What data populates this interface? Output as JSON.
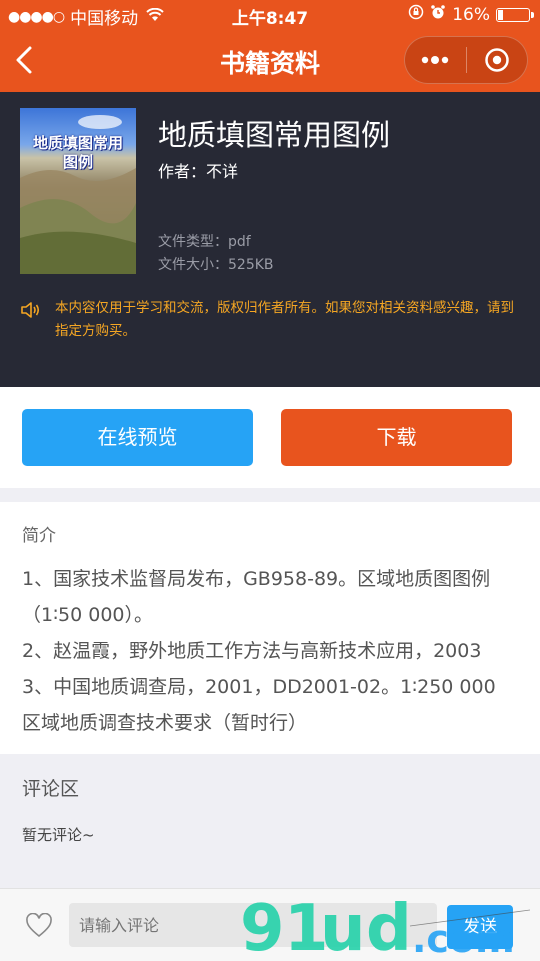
{
  "status_bar": {
    "carrier": "中国移动",
    "time": "上午8:47",
    "battery": "16%"
  },
  "navbar": {
    "title": "书籍资料",
    "icons": [
      "back-arrow-icon",
      "more-dots-icon",
      "close-circle-icon"
    ]
  },
  "book": {
    "cover_text": "地质填图常用图例",
    "title": "地质填图常用图例",
    "author": "作者：不详",
    "file_type": "文件类型：pdf",
    "file_size": "文件大小：525KB",
    "notice": "本内容仅用于学习和交流，版权归作者所有。如果您对相关资料感兴趣，请到指定方购买。"
  },
  "buttons": {
    "preview": "在线预览",
    "download": "下载"
  },
  "intro": {
    "label": "简介",
    "lines": [
      "1、国家技术监督局发布，GB958-89。区域地质图图例",
      "（1∶50 000）。",
      "2、赵温霞，野外地质工作方法与高新技术应用，2003",
      "3、中国地质调查局，2001，DD2001-02。1∶250 000",
      "区域地质调查技术要求（暂时行）"
    ]
  },
  "comments": {
    "title": "评论区",
    "empty": "暂无评论~"
  },
  "comment_bar": {
    "placeholder": "请输入评论",
    "send": "发送"
  },
  "colors": {
    "brand_orange": "#e8541e",
    "accent_blue": "#26a3f5",
    "hero_bg": "#272935",
    "notice_yellow": "#f5a623"
  }
}
